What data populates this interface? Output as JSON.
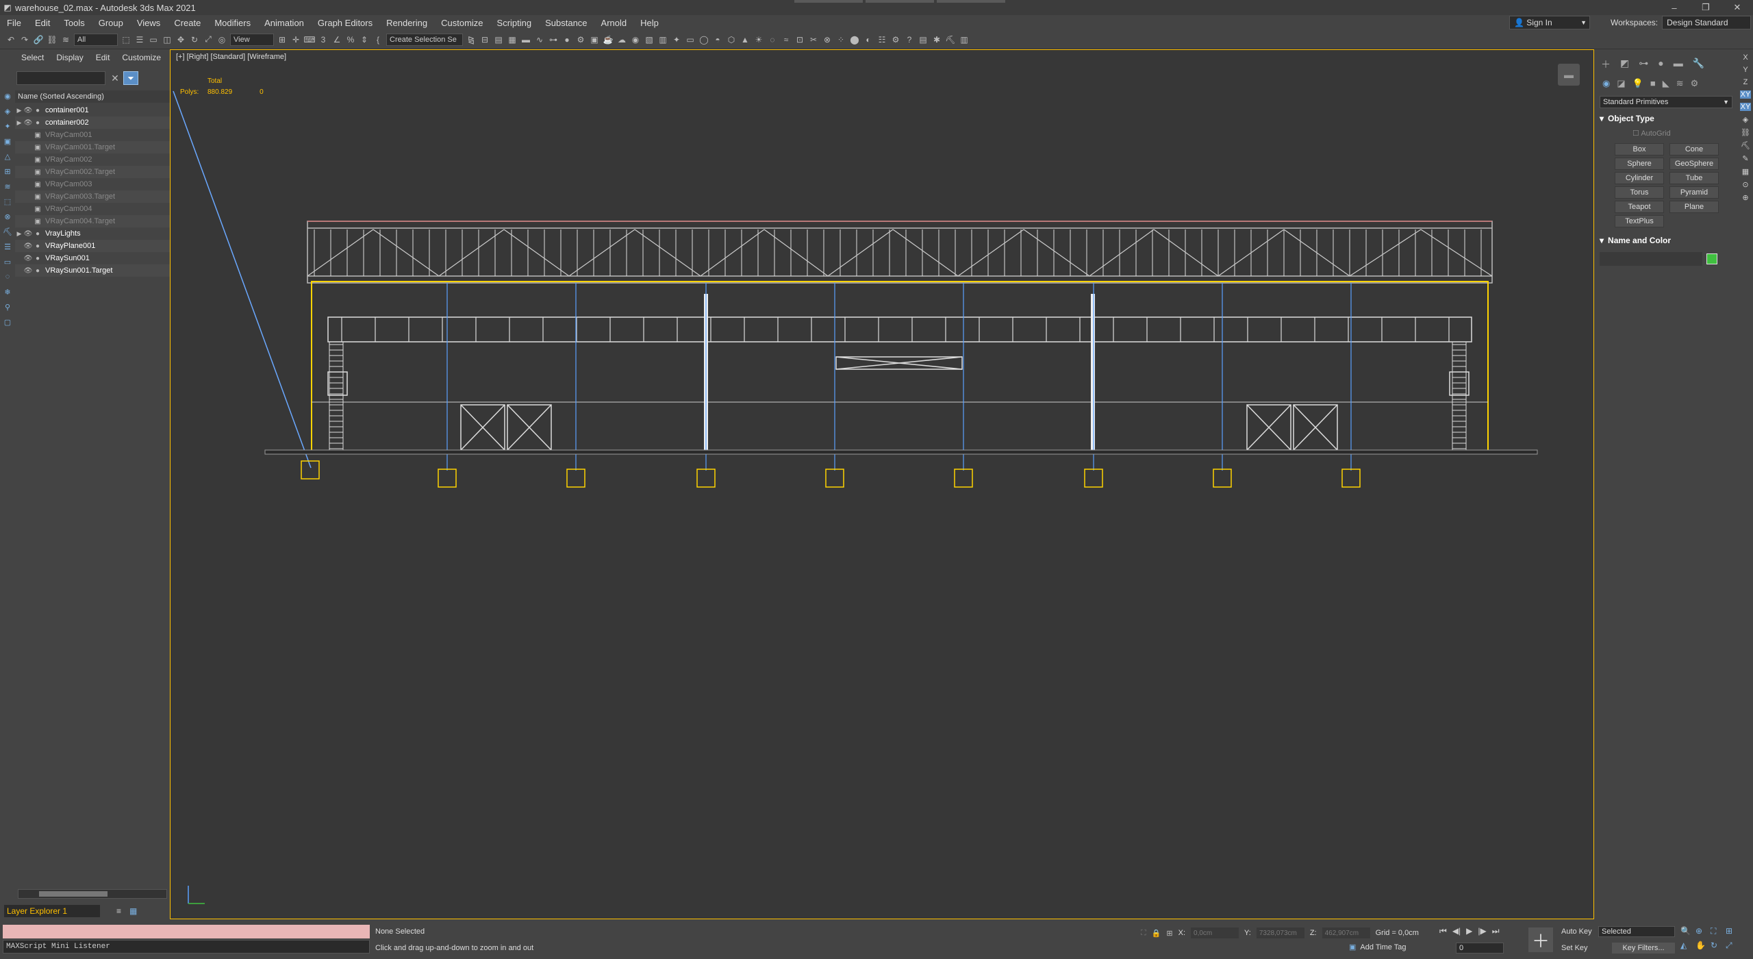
{
  "window": {
    "title": "warehouse_02.max - Autodesk 3ds Max 2021",
    "controls": [
      "–",
      "❐",
      "✕"
    ]
  },
  "menu": [
    "File",
    "Edit",
    "Tools",
    "Group",
    "Views",
    "Create",
    "Modifiers",
    "Animation",
    "Graph Editors",
    "Rendering",
    "Customize",
    "Scripting",
    "Substance",
    "Arnold",
    "Help"
  ],
  "signin": "Sign In",
  "workspaces": {
    "label": "Workspaces:",
    "value": "Design Standard"
  },
  "toolbar": {
    "filter": "All",
    "refcoord": "View",
    "selset": "Create Selection Se"
  },
  "scene_explorer": {
    "tabs": [
      "Select",
      "Display",
      "Edit",
      "Customize"
    ],
    "header": "Name (Sorted Ascending)",
    "items": [
      {
        "name": "container001",
        "expand": true,
        "dim": false
      },
      {
        "name": "container002",
        "expand": true,
        "dim": false
      },
      {
        "name": "VRayCam001",
        "expand": false,
        "dim": true
      },
      {
        "name": "VRayCam001.Target",
        "expand": false,
        "dim": true
      },
      {
        "name": "VRayCam002",
        "expand": false,
        "dim": true
      },
      {
        "name": "VRayCam002.Target",
        "expand": false,
        "dim": true
      },
      {
        "name": "VRayCam003",
        "expand": false,
        "dim": true
      },
      {
        "name": "VRayCam003.Target",
        "expand": false,
        "dim": true
      },
      {
        "name": "VRayCam004",
        "expand": false,
        "dim": true
      },
      {
        "name": "VRayCam004.Target",
        "expand": false,
        "dim": true
      },
      {
        "name": "VrayLights",
        "expand": true,
        "dim": false
      },
      {
        "name": "VRayPlane001",
        "expand": false,
        "dim": false
      },
      {
        "name": "VRaySun001",
        "expand": false,
        "dim": false
      },
      {
        "name": "VRaySun001.Target",
        "expand": false,
        "dim": false
      }
    ],
    "layer": "Layer Explorer 1"
  },
  "viewport": {
    "label": "[+] [Right] [Standard] [Wireframe]",
    "stats_total": "Total",
    "stats_polys_label": "Polys:",
    "stats_polys_total": "880.829",
    "stats_polys_sel": "0"
  },
  "command_panel": {
    "category": "Standard Primitives",
    "object_type": "Object Type",
    "autogrid": "AutoGrid",
    "primitives": [
      "Box",
      "Cone",
      "Sphere",
      "GeoSphere",
      "Cylinder",
      "Tube",
      "Torus",
      "Pyramid",
      "Teapot",
      "Plane",
      "TextPlus"
    ],
    "name_color": "Name and Color",
    "swatch_color": "#40c040"
  },
  "axis_strip": [
    "X",
    "Y",
    "Z",
    "XY",
    "XY"
  ],
  "status": {
    "selection": "None Selected",
    "prompt": "Click and drag up-and-down to zoom in and out",
    "maxscript": "MAXScript Mini Listener",
    "x_label": "X:",
    "x_val": "0,0cm",
    "y_label": "Y:",
    "y_val": "7328,073cm",
    "z_label": "Z:",
    "z_val": "462,907cm",
    "grid": "Grid = 0,0cm",
    "add_time_tag": "Add Time Tag",
    "frame": "0",
    "auto_key": "Auto Key",
    "set_key": "Set Key",
    "selected": "Selected",
    "key_filters": "Key Filters..."
  }
}
